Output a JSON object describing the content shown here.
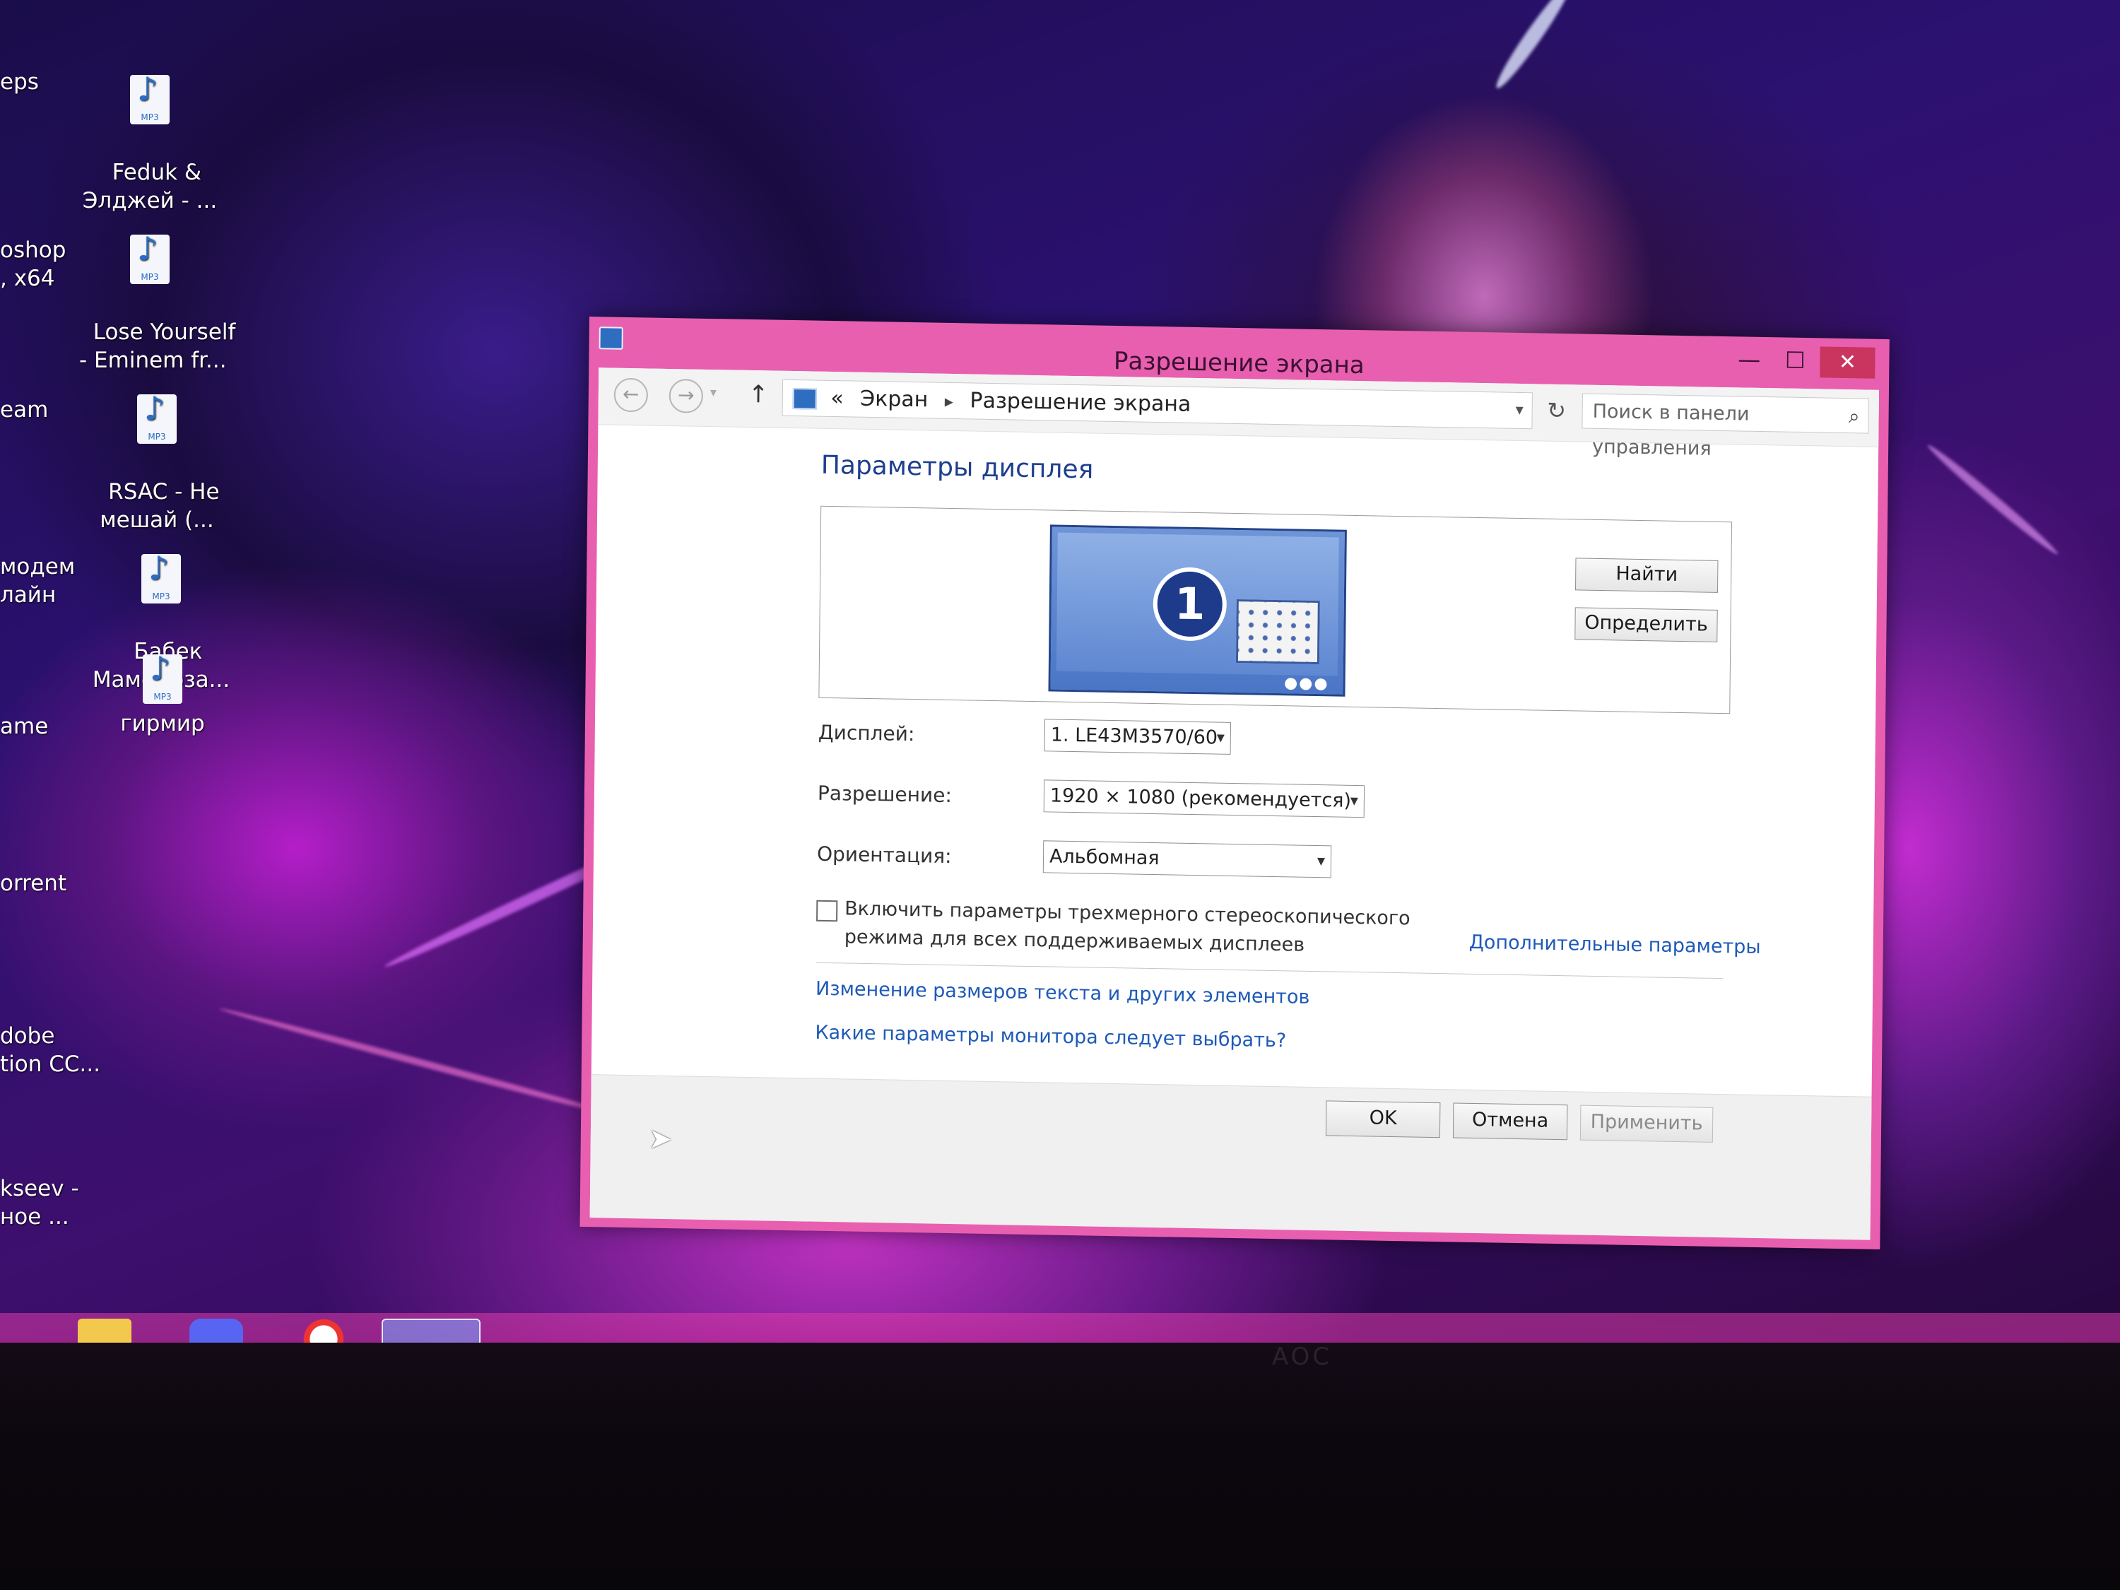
{
  "desktop": {
    "icons": [
      {
        "label": "Feduk &\nЭлджей - ..."
      },
      {
        "label": "Lose Yourself\n- Eminem fr..."
      },
      {
        "label": "RSAC - Не\nмешай (..."
      },
      {
        "label": "Бабек\nМамедрза..."
      },
      {
        "label": "гирмир"
      }
    ],
    "icon_badge": "MP3",
    "cut_labels": [
      "eps",
      "oshop\n, x64",
      "eam",
      "модем\nлайн",
      "ame",
      "orrent",
      "dobe\ntion CC...",
      "kseev -\nное ..."
    ],
    "monitor_brand": "AOC"
  },
  "taskbar": {
    "items": [
      "folder-icon",
      "discord-icon",
      "yandex-browser-icon",
      "control-panel-icon"
    ]
  },
  "window": {
    "title": "Разрешение экрана",
    "controls": {
      "minimize": "—",
      "maximize": "☐",
      "close": "✕"
    },
    "nav": {
      "back": "←",
      "forward": "→",
      "up": "↑",
      "breadcrumb_prefix": "«",
      "breadcrumbs": [
        "Экран",
        "Разрешение экрана"
      ],
      "refresh": "↻",
      "search_placeholder": "Поиск в панели управления"
    },
    "heading": "Параметры дисплея",
    "preview": {
      "monitor_number": "1",
      "find_button": "Найти",
      "identify_button": "Определить"
    },
    "fields": {
      "display_label": "Дисплей:",
      "display_value": "1. LE43M3570/60",
      "resolution_label": "Разрешение:",
      "resolution_value": "1920 × 1080 (рекомендуется)",
      "orientation_label": "Ориентация:",
      "orientation_value": "Альбомная"
    },
    "stereo_checkbox": {
      "checked": false,
      "text": "Включить параметры трехмерного стереоскопического режима для всех поддерживаемых дисплеев"
    },
    "advanced_link": "Дополнительные параметры",
    "links": {
      "text_size": "Изменение размеров текста и других элементов",
      "which_settings": "Какие параметры монитора следует выбрать?"
    },
    "buttons": {
      "ok": "OK",
      "cancel": "Отмена",
      "apply": "Применить"
    }
  },
  "colors": {
    "accent_frame": "#e85fb0",
    "link": "#1e5ab8",
    "heading": "#1e3f8f",
    "close": "#c9355e"
  }
}
